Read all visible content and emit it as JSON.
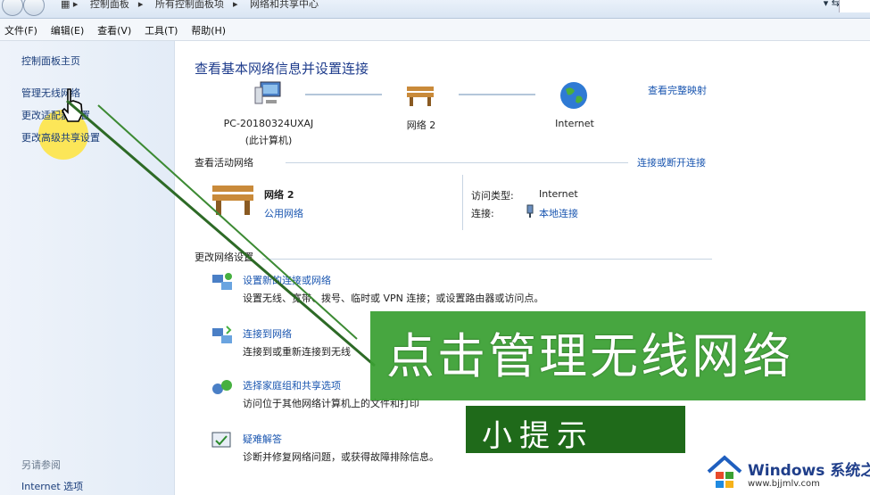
{
  "address_bar": {
    "crumbs": [
      "控制面板",
      "所有控制面板项",
      "网络和共享中心"
    ]
  },
  "menu": [
    "文件(F)",
    "编辑(E)",
    "查看(V)",
    "工具(T)",
    "帮助(H)"
  ],
  "sidebar": {
    "items": [
      {
        "label": "控制面板主页"
      },
      {
        "label": "管理无线网络"
      },
      {
        "label": "更改适配器设置"
      },
      {
        "label": "更改高级共享设置"
      }
    ],
    "see_also": "另请参阅",
    "internet_options": "Internet 选项"
  },
  "main": {
    "title": "查看基本网络信息并设置连接",
    "full_map": "查看完整映射",
    "nodes": [
      {
        "label": "PC-20180324UXAJ",
        "sub": "(此计算机)",
        "icon": "computer-icon"
      },
      {
        "label": "网络  2",
        "sub": "",
        "icon": "bench-icon"
      },
      {
        "label": "Internet",
        "sub": "",
        "icon": "globe-icon"
      }
    ],
    "active_networks_label": "查看活动网络",
    "connect_disconnect": "连接或断开连接",
    "network_name": "网络  2",
    "network_type": "公用网络",
    "access_type_label": "访问类型:",
    "access_type_value": "Internet",
    "connection_label": "连接:",
    "connection_value": "本地连接",
    "change_settings_label": "更改网络设置",
    "tasks": [
      {
        "title": "设置新的连接或网络",
        "desc": "设置无线、宽带、拨号、临时或 VPN 连接；或设置路由器或访问点。",
        "icon": "network-setup-icon"
      },
      {
        "title": "连接到网络",
        "desc": "连接到或重新连接到无线",
        "icon": "connect-network-icon"
      },
      {
        "title": "选择家庭组和共享选项",
        "desc": "访问位于其他网络计算机上的文件和打印",
        "icon": "homegroup-icon"
      },
      {
        "title": "疑难解答",
        "desc": "诊断并修复网络问题，或获得故障排除信息。",
        "icon": "troubleshoot-icon"
      }
    ]
  },
  "overlay": {
    "headline": "点击管理无线网络",
    "tip": "小提示"
  },
  "watermark": {
    "brand": "Windows 系统之家",
    "url": "www.bjjmlv.com"
  },
  "colors": {
    "link": "#1a56b0",
    "title": "#1e3c8c",
    "overlay_green": "#3aa032",
    "tip_green": "#1f6a1a"
  }
}
